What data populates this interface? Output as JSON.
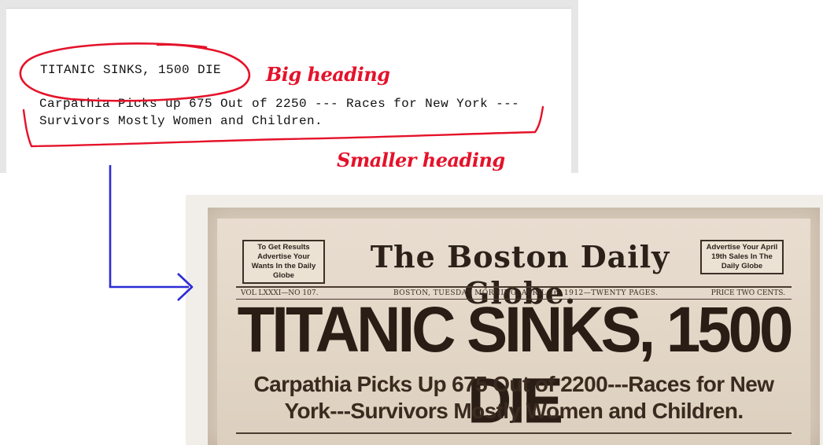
{
  "editor": {
    "big_heading_text": "TITANIC SINKS, 1500 DIE",
    "smaller_heading_line1": "Carpathia Picks up 675 Out of 2250 --- Races for New York ---",
    "smaller_heading_line2": "Survivors Mostly Women and Children."
  },
  "annotations": {
    "big_label": "Big heading",
    "small_label": "Smaller heading",
    "mark_color": "#e5122a",
    "arrow_color": "#2b2bd6"
  },
  "newspaper": {
    "ear_left": "To Get Results Advertise Your Wants In the Daily Globe",
    "ear_right": "Advertise Your April 19th Sales In The Daily Globe",
    "masthead": "The Boston Daily Globe.",
    "dateline_vol": "VOL LXXXI—NO 107.",
    "dateline_mid": "BOSTON, TUESDAY MORNING, APRIL 16, 1912—TWENTY PAGES.",
    "dateline_price": "PRICE TWO CENTS.",
    "headline": "TITANIC SINKS, 1500 DIE",
    "subhead_line1": "Carpathia Picks Up 675 Out of 2200---Races for New",
    "subhead_line2": "York---Survivors Mostly Women and Children."
  }
}
